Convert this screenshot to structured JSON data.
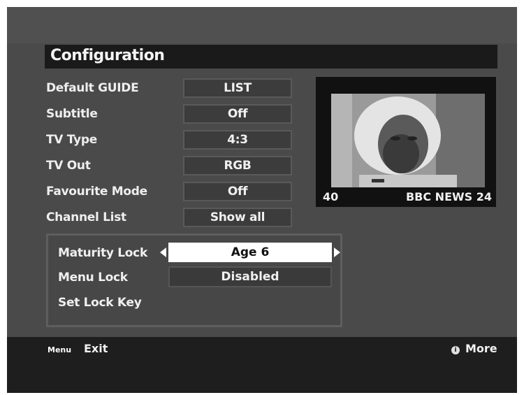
{
  "title": "Configuration",
  "settings": [
    {
      "label": "Default GUIDE",
      "value": "LIST"
    },
    {
      "label": "Subtitle",
      "value": "Off"
    },
    {
      "label": "TV Type",
      "value": "4:3"
    },
    {
      "label": "TV Out",
      "value": "RGB"
    },
    {
      "label": "Favourite Mode",
      "value": "Off"
    },
    {
      "label": "Channel List",
      "value": "Show all"
    }
  ],
  "preview": {
    "channel_number": "40",
    "channel_name": "BBC NEWS 24"
  },
  "lock_panel": {
    "maturity_label": "Maturity Lock",
    "maturity_value": "Age 6",
    "menu_lock_label": "Menu Lock",
    "menu_lock_value": "Disabled",
    "set_key_label": "Set Lock Key"
  },
  "footer": {
    "menu_key": "Menu",
    "exit_label": "Exit",
    "info_key": "i",
    "more_label": "More"
  },
  "colors": {
    "background": "#4a4a4a",
    "bar": "#1a1a1a",
    "highlight": "#ffffff"
  },
  "icons": [
    "left-arrow-icon",
    "right-arrow-icon",
    "info-icon"
  ]
}
